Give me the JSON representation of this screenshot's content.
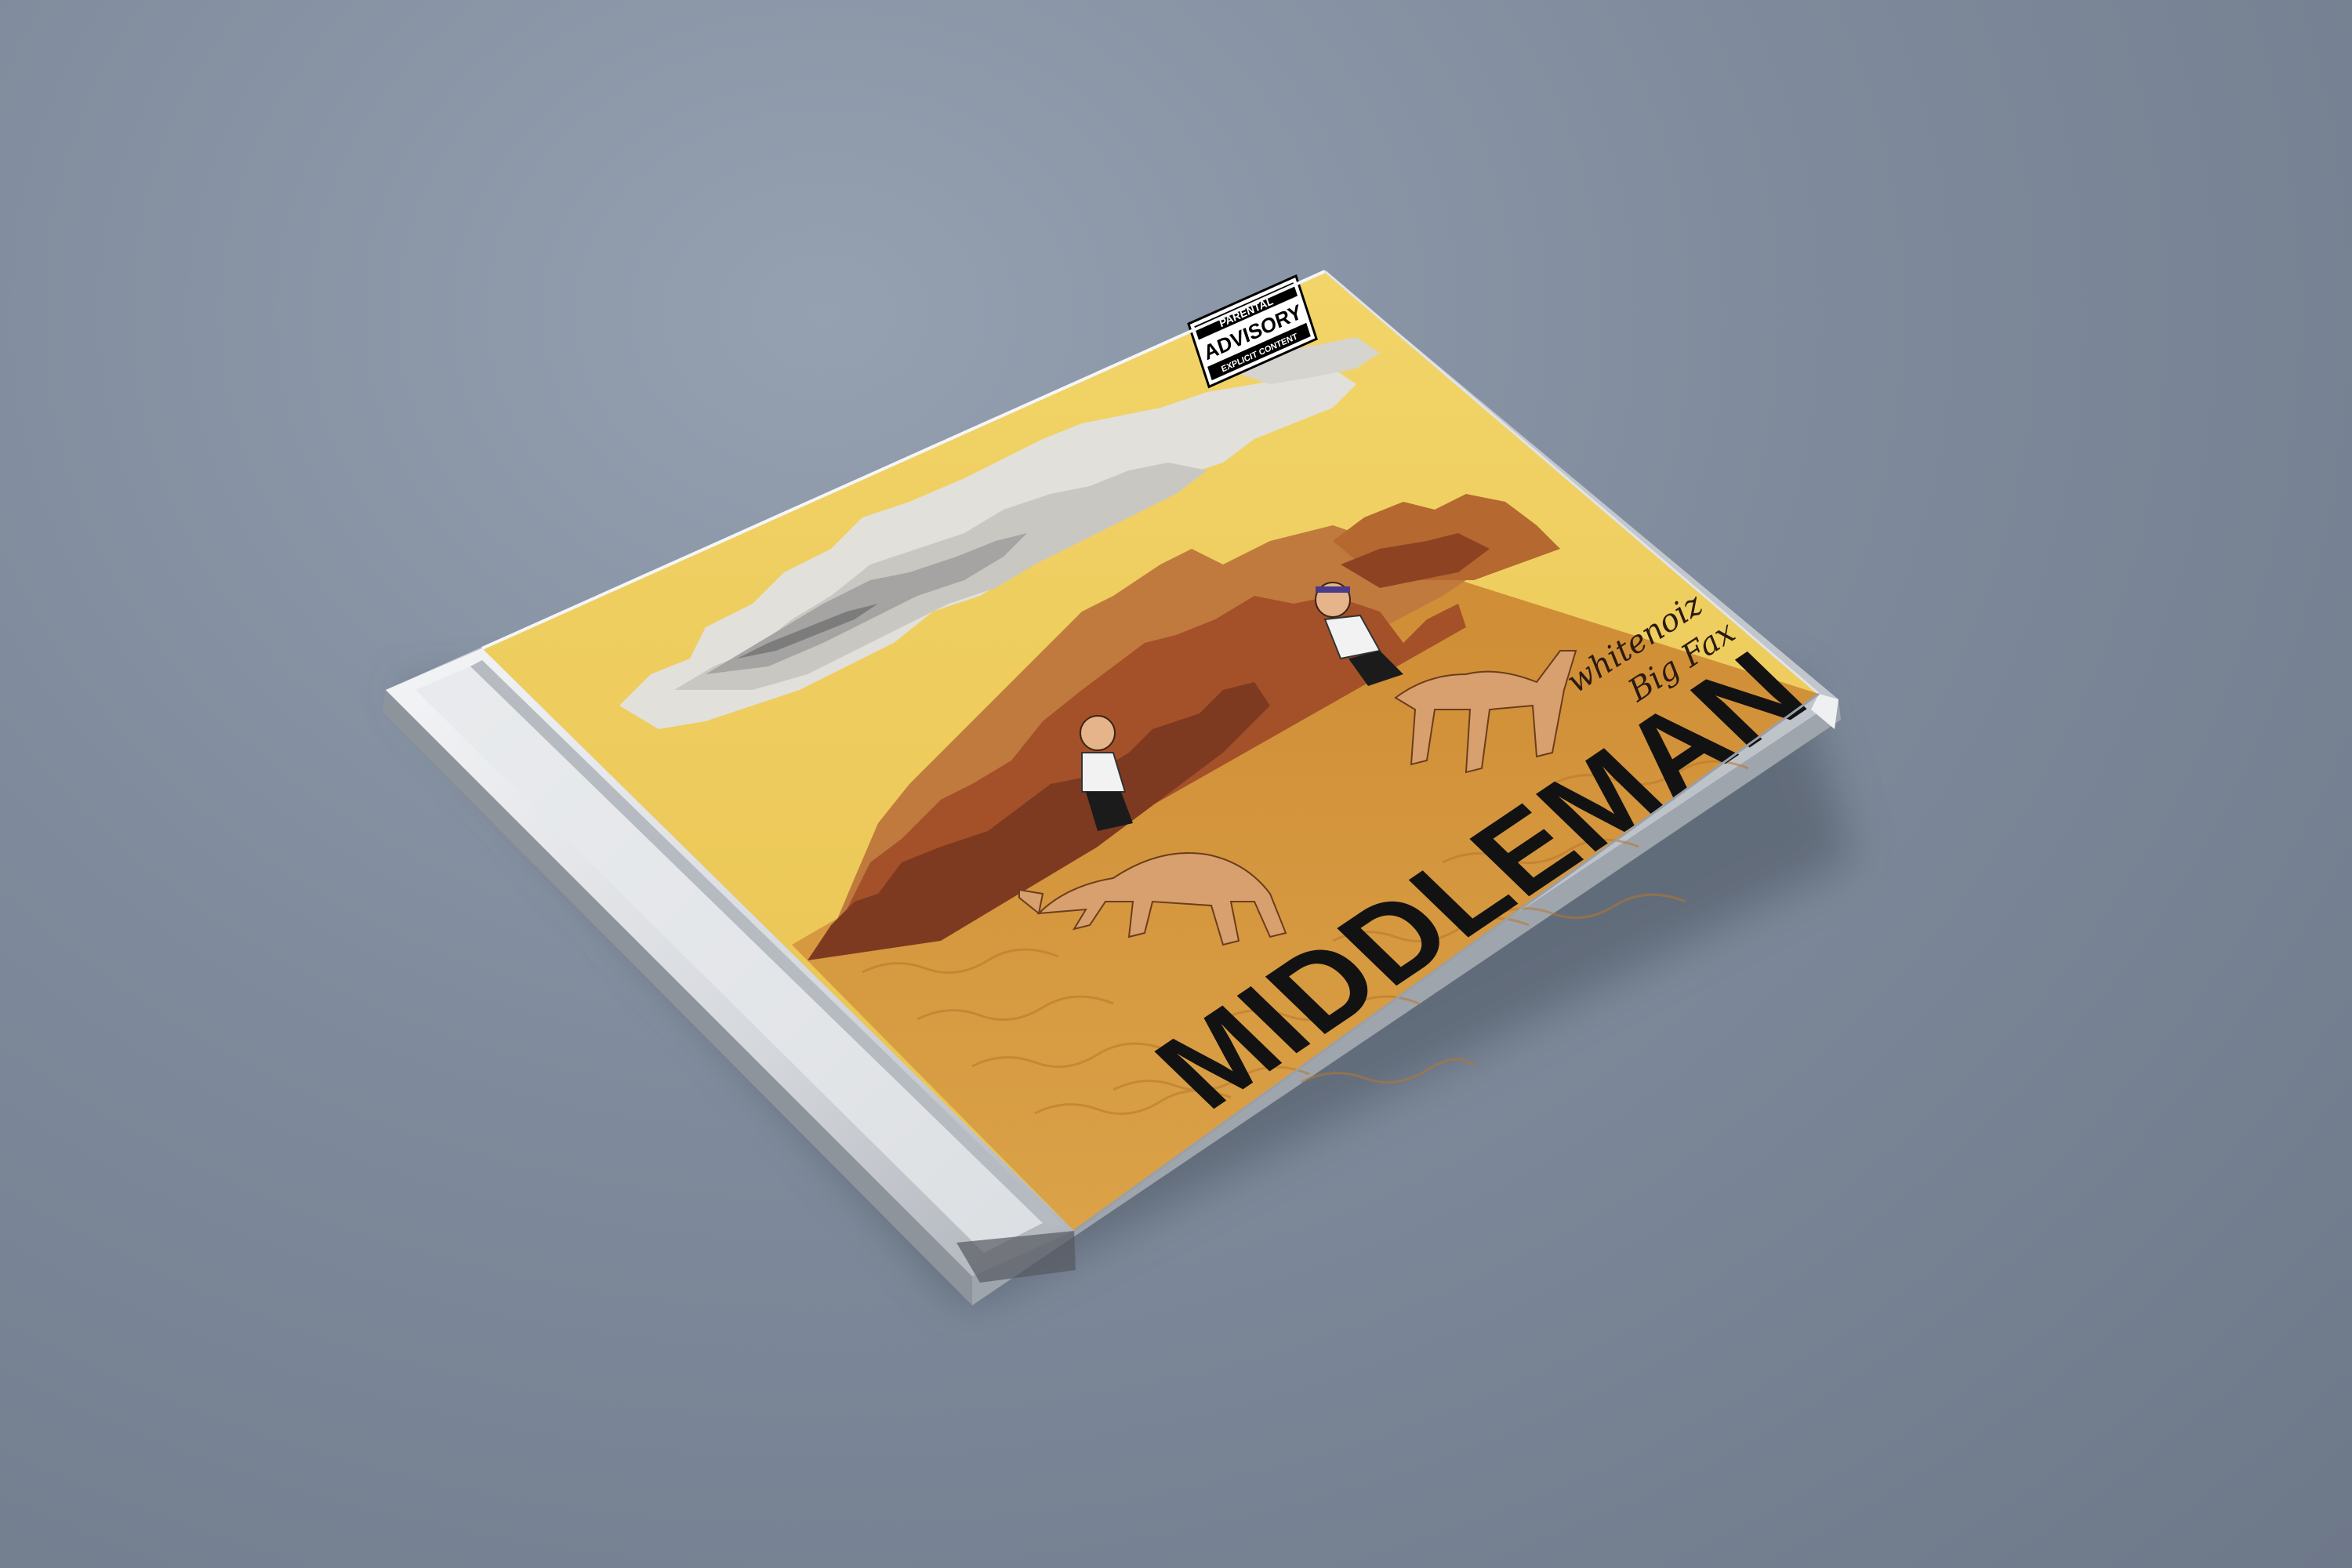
{
  "album": {
    "title": "MIDDLEMAN",
    "artists": [
      "whitenoiz",
      "Big Fax"
    ]
  },
  "advisory": {
    "line1": "PARENTAL",
    "line2": "ADVISORY",
    "line3": "EXPLICIT CONTENT"
  },
  "colors": {
    "background": "#7f8b9c",
    "sky": "#ecc95a",
    "sand": "#d49a3c",
    "mountain_dark": "#7e3a20",
    "mountain_mid": "#a4512a",
    "mountain_light": "#c07a3e",
    "cloud": "#d8d6d2",
    "camel": "#d8a06e",
    "title_text": "#121212"
  }
}
